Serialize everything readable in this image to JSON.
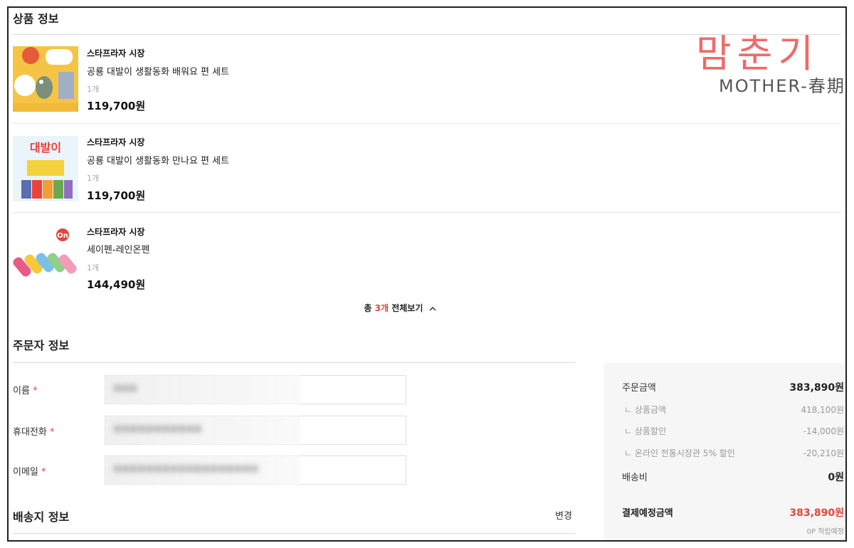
{
  "product_section": {
    "title": "상품 정보",
    "items": [
      {
        "seller": "스타프라자 시장",
        "name": "공룡 대발이 생활동화 배워요 편 세트",
        "qty": "1개",
        "price": "119,700원"
      },
      {
        "seller": "스타프라자 시장",
        "name": "공룡 대발이 생활동화 만나요 편 세트",
        "qty": "1개",
        "price": "119,700원"
      },
      {
        "seller": "스타프라자 시장",
        "name": "세이펜-레인온펜",
        "qty": "1개",
        "price": "144,490원"
      }
    ],
    "summary": {
      "prefix": "총 ",
      "count": "3개",
      "suffix": " 전체보기"
    }
  },
  "orderer_section": {
    "title": "주문자 정보",
    "fields": [
      {
        "label": "이름",
        "required_mark": "*"
      },
      {
        "label": "휴대전화",
        "required_mark": "*"
      },
      {
        "label": "이메일",
        "required_mark": "*"
      }
    ]
  },
  "shipping_section": {
    "title": "배송지 정보",
    "change_label": "변경"
  },
  "payment": {
    "rows": [
      {
        "label": "주문금액",
        "value": "383,890원"
      },
      {
        "label": "ㄴ 상품금액",
        "value": "418,100원"
      },
      {
        "label": "ㄴ 상품할인",
        "value": "-14,000원"
      },
      {
        "label": "ㄴ 온라인 전통시장관 5% 할인",
        "value": "-20,210원"
      },
      {
        "label": "배송비",
        "value": "0원"
      }
    ],
    "total_label": "결제예정금액",
    "total_value": "383,890원",
    "points_note": "0P 적립예정"
  },
  "watermark": {
    "line1": "맘춘기",
    "line2": "MOTHER-春期"
  },
  "colors": {
    "accent": "#e2473a",
    "panel_bg": "#f6f6f7"
  }
}
